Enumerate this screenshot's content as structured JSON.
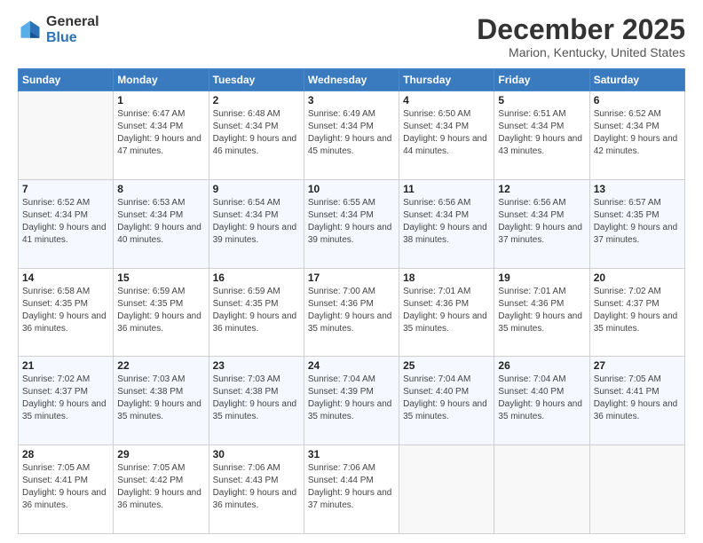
{
  "header": {
    "logo": {
      "general": "General",
      "blue": "Blue"
    },
    "title": "December 2025",
    "subtitle": "Marion, Kentucky, United States"
  },
  "calendar": {
    "days_of_week": [
      "Sunday",
      "Monday",
      "Tuesday",
      "Wednesday",
      "Thursday",
      "Friday",
      "Saturday"
    ],
    "weeks": [
      [
        {
          "day": "",
          "empty": true
        },
        {
          "day": "1",
          "sunrise": "Sunrise: 6:47 AM",
          "sunset": "Sunset: 4:34 PM",
          "daylight": "Daylight: 9 hours and 47 minutes."
        },
        {
          "day": "2",
          "sunrise": "Sunrise: 6:48 AM",
          "sunset": "Sunset: 4:34 PM",
          "daylight": "Daylight: 9 hours and 46 minutes."
        },
        {
          "day": "3",
          "sunrise": "Sunrise: 6:49 AM",
          "sunset": "Sunset: 4:34 PM",
          "daylight": "Daylight: 9 hours and 45 minutes."
        },
        {
          "day": "4",
          "sunrise": "Sunrise: 6:50 AM",
          "sunset": "Sunset: 4:34 PM",
          "daylight": "Daylight: 9 hours and 44 minutes."
        },
        {
          "day": "5",
          "sunrise": "Sunrise: 6:51 AM",
          "sunset": "Sunset: 4:34 PM",
          "daylight": "Daylight: 9 hours and 43 minutes."
        },
        {
          "day": "6",
          "sunrise": "Sunrise: 6:52 AM",
          "sunset": "Sunset: 4:34 PM",
          "daylight": "Daylight: 9 hours and 42 minutes."
        }
      ],
      [
        {
          "day": "7",
          "sunrise": "Sunrise: 6:52 AM",
          "sunset": "Sunset: 4:34 PM",
          "daylight": "Daylight: 9 hours and 41 minutes."
        },
        {
          "day": "8",
          "sunrise": "Sunrise: 6:53 AM",
          "sunset": "Sunset: 4:34 PM",
          "daylight": "Daylight: 9 hours and 40 minutes."
        },
        {
          "day": "9",
          "sunrise": "Sunrise: 6:54 AM",
          "sunset": "Sunset: 4:34 PM",
          "daylight": "Daylight: 9 hours and 39 minutes."
        },
        {
          "day": "10",
          "sunrise": "Sunrise: 6:55 AM",
          "sunset": "Sunset: 4:34 PM",
          "daylight": "Daylight: 9 hours and 39 minutes."
        },
        {
          "day": "11",
          "sunrise": "Sunrise: 6:56 AM",
          "sunset": "Sunset: 4:34 PM",
          "daylight": "Daylight: 9 hours and 38 minutes."
        },
        {
          "day": "12",
          "sunrise": "Sunrise: 6:56 AM",
          "sunset": "Sunset: 4:34 PM",
          "daylight": "Daylight: 9 hours and 37 minutes."
        },
        {
          "day": "13",
          "sunrise": "Sunrise: 6:57 AM",
          "sunset": "Sunset: 4:35 PM",
          "daylight": "Daylight: 9 hours and 37 minutes."
        }
      ],
      [
        {
          "day": "14",
          "sunrise": "Sunrise: 6:58 AM",
          "sunset": "Sunset: 4:35 PM",
          "daylight": "Daylight: 9 hours and 36 minutes."
        },
        {
          "day": "15",
          "sunrise": "Sunrise: 6:59 AM",
          "sunset": "Sunset: 4:35 PM",
          "daylight": "Daylight: 9 hours and 36 minutes."
        },
        {
          "day": "16",
          "sunrise": "Sunrise: 6:59 AM",
          "sunset": "Sunset: 4:35 PM",
          "daylight": "Daylight: 9 hours and 36 minutes."
        },
        {
          "day": "17",
          "sunrise": "Sunrise: 7:00 AM",
          "sunset": "Sunset: 4:36 PM",
          "daylight": "Daylight: 9 hours and 35 minutes."
        },
        {
          "day": "18",
          "sunrise": "Sunrise: 7:01 AM",
          "sunset": "Sunset: 4:36 PM",
          "daylight": "Daylight: 9 hours and 35 minutes."
        },
        {
          "day": "19",
          "sunrise": "Sunrise: 7:01 AM",
          "sunset": "Sunset: 4:36 PM",
          "daylight": "Daylight: 9 hours and 35 minutes."
        },
        {
          "day": "20",
          "sunrise": "Sunrise: 7:02 AM",
          "sunset": "Sunset: 4:37 PM",
          "daylight": "Daylight: 9 hours and 35 minutes."
        }
      ],
      [
        {
          "day": "21",
          "sunrise": "Sunrise: 7:02 AM",
          "sunset": "Sunset: 4:37 PM",
          "daylight": "Daylight: 9 hours and 35 minutes."
        },
        {
          "day": "22",
          "sunrise": "Sunrise: 7:03 AM",
          "sunset": "Sunset: 4:38 PM",
          "daylight": "Daylight: 9 hours and 35 minutes."
        },
        {
          "day": "23",
          "sunrise": "Sunrise: 7:03 AM",
          "sunset": "Sunset: 4:38 PM",
          "daylight": "Daylight: 9 hours and 35 minutes."
        },
        {
          "day": "24",
          "sunrise": "Sunrise: 7:04 AM",
          "sunset": "Sunset: 4:39 PM",
          "daylight": "Daylight: 9 hours and 35 minutes."
        },
        {
          "day": "25",
          "sunrise": "Sunrise: 7:04 AM",
          "sunset": "Sunset: 4:40 PM",
          "daylight": "Daylight: 9 hours and 35 minutes."
        },
        {
          "day": "26",
          "sunrise": "Sunrise: 7:04 AM",
          "sunset": "Sunset: 4:40 PM",
          "daylight": "Daylight: 9 hours and 35 minutes."
        },
        {
          "day": "27",
          "sunrise": "Sunrise: 7:05 AM",
          "sunset": "Sunset: 4:41 PM",
          "daylight": "Daylight: 9 hours and 36 minutes."
        }
      ],
      [
        {
          "day": "28",
          "sunrise": "Sunrise: 7:05 AM",
          "sunset": "Sunset: 4:41 PM",
          "daylight": "Daylight: 9 hours and 36 minutes."
        },
        {
          "day": "29",
          "sunrise": "Sunrise: 7:05 AM",
          "sunset": "Sunset: 4:42 PM",
          "daylight": "Daylight: 9 hours and 36 minutes."
        },
        {
          "day": "30",
          "sunrise": "Sunrise: 7:06 AM",
          "sunset": "Sunset: 4:43 PM",
          "daylight": "Daylight: 9 hours and 36 minutes."
        },
        {
          "day": "31",
          "sunrise": "Sunrise: 7:06 AM",
          "sunset": "Sunset: 4:44 PM",
          "daylight": "Daylight: 9 hours and 37 minutes."
        },
        {
          "day": "",
          "empty": true
        },
        {
          "day": "",
          "empty": true
        },
        {
          "day": "",
          "empty": true
        }
      ]
    ]
  }
}
